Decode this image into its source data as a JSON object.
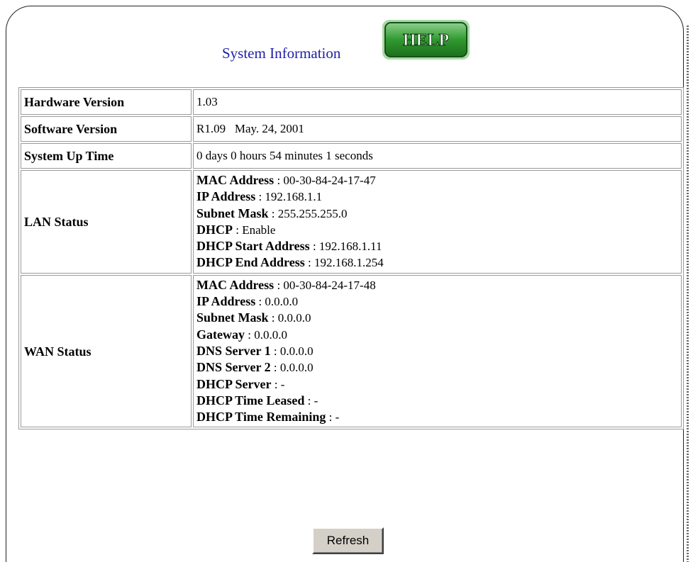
{
  "page": {
    "title": "System Information",
    "help_label": "HELP",
    "refresh_label": "Refresh"
  },
  "rows": {
    "hardware": {
      "label": "Hardware Version",
      "value": "1.03"
    },
    "software": {
      "label": "Software Version",
      "value": "R1.09   May. 24, 2001"
    },
    "uptime": {
      "label": "System Up Time",
      "value": "0 days 0 hours 54 minutes 1 seconds"
    }
  },
  "lan": {
    "label": "LAN Status",
    "items": [
      {
        "key": "MAC Address",
        "value": " : 00-30-84-24-17-47"
      },
      {
        "key": "IP Address",
        "value": " : 192.168.1.1"
      },
      {
        "key": "Subnet Mask",
        "value": " : 255.255.255.0"
      },
      {
        "key": "DHCP",
        "value": " : Enable"
      },
      {
        "key": "DHCP Start Address",
        "value": " : 192.168.1.11"
      },
      {
        "key": "DHCP End Address",
        "value": " : 192.168.1.254"
      }
    ]
  },
  "wan": {
    "label": "WAN Status",
    "items": [
      {
        "key": "MAC Address",
        "value": " : 00-30-84-24-17-48"
      },
      {
        "key": "IP Address",
        "value": " : 0.0.0.0"
      },
      {
        "key": "Subnet Mask",
        "value": " : 0.0.0.0"
      },
      {
        "key": "Gateway",
        "value": " : 0.0.0.0"
      },
      {
        "key": "DNS Server 1",
        "value": " : 0.0.0.0"
      },
      {
        "key": "DNS Server 2",
        "value": " : 0.0.0.0"
      },
      {
        "key": "DHCP Server",
        "value": " : -"
      },
      {
        "key": "DHCP Time Leased",
        "value": " : -"
      },
      {
        "key": "DHCP Time Remaining",
        "value": " : -"
      }
    ]
  },
  "colors": {
    "title": "#1f1fa8",
    "help_green": "#2e8b2e",
    "border": "#9a9a9a",
    "button_face": "#d4d0c8"
  }
}
